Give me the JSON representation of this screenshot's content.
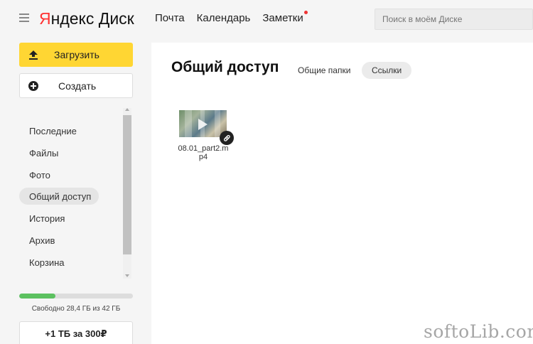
{
  "header": {
    "logo_brand": "Яндекс",
    "logo_product": "Диск",
    "nav": [
      "Почта",
      "Календарь",
      "Заметки"
    ],
    "search_placeholder": "Поиск в моём Диске"
  },
  "sidebar": {
    "upload_label": "Загрузить",
    "create_label": "Создать",
    "items": [
      {
        "label": "Последние",
        "active": false
      },
      {
        "label": "Файлы",
        "active": false
      },
      {
        "label": "Фото",
        "active": false
      },
      {
        "label": "Общий доступ",
        "active": true
      },
      {
        "label": "История",
        "active": false
      },
      {
        "label": "Архив",
        "active": false
      },
      {
        "label": "Корзина",
        "active": false
      }
    ],
    "storage_text": "Свободно 28,4 ГБ из 42 ГБ",
    "storage_used_fraction": 0.32,
    "promo_label": "+1 ТБ за 300₽"
  },
  "main": {
    "title": "Общий доступ",
    "tabs": [
      {
        "label": "Общие папки",
        "active": false
      },
      {
        "label": "Ссылки",
        "active": true
      }
    ],
    "files": [
      {
        "name": "08.01_part2.mp4",
        "icon": "link-icon"
      }
    ]
  },
  "watermark": "softoLib.com",
  "colors": {
    "accent_yellow": "#ffd633",
    "storage_green": "#5cc160",
    "logo_red": "#ff3333"
  }
}
